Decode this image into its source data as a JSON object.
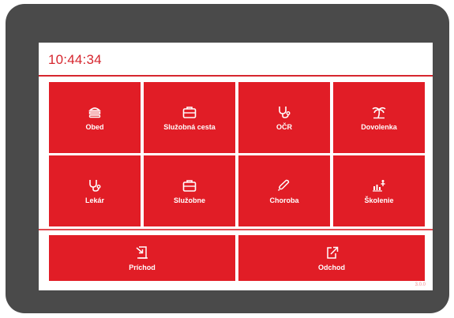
{
  "header": {
    "time": "10:44:34"
  },
  "tiles": [
    {
      "label": "Obed",
      "icon": "food-icon"
    },
    {
      "label": "Služobná cesta",
      "icon": "briefcase-icon"
    },
    {
      "label": "OČR",
      "icon": "stethoscope-icon"
    },
    {
      "label": "Dovolenka",
      "icon": "palm-tree-icon"
    },
    {
      "label": "Lekár",
      "icon": "stethoscope-icon"
    },
    {
      "label": "Služobne",
      "icon": "briefcase-icon"
    },
    {
      "label": "Choroba",
      "icon": "thermometer-icon"
    },
    {
      "label": "Školenie",
      "icon": "training-icon"
    }
  ],
  "actions": [
    {
      "label": "Príchod",
      "icon": "arrival-icon"
    },
    {
      "label": "Odchod",
      "icon": "departure-icon"
    }
  ],
  "version": "3.0.0",
  "colors": {
    "accent": "#e11d26",
    "frame": "#4a4a4a",
    "background": "#ffffff"
  }
}
